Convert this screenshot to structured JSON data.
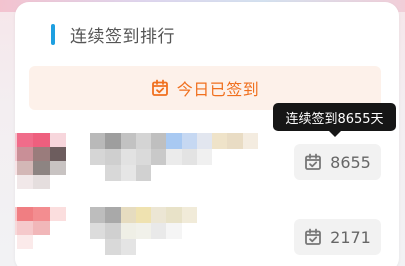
{
  "header": {
    "title": "连续签到排行",
    "accent_color": "#1e9fe0"
  },
  "signed_banner": {
    "label": "今日已签到",
    "icon": "calendar-check-icon",
    "color": "#f0701f"
  },
  "tooltip": {
    "text": "连续签到8655天"
  },
  "ranking": [
    {
      "days": "8655",
      "icon": "calendar-check-icon"
    },
    {
      "days": "2171",
      "icon": "calendar-check-icon"
    }
  ]
}
